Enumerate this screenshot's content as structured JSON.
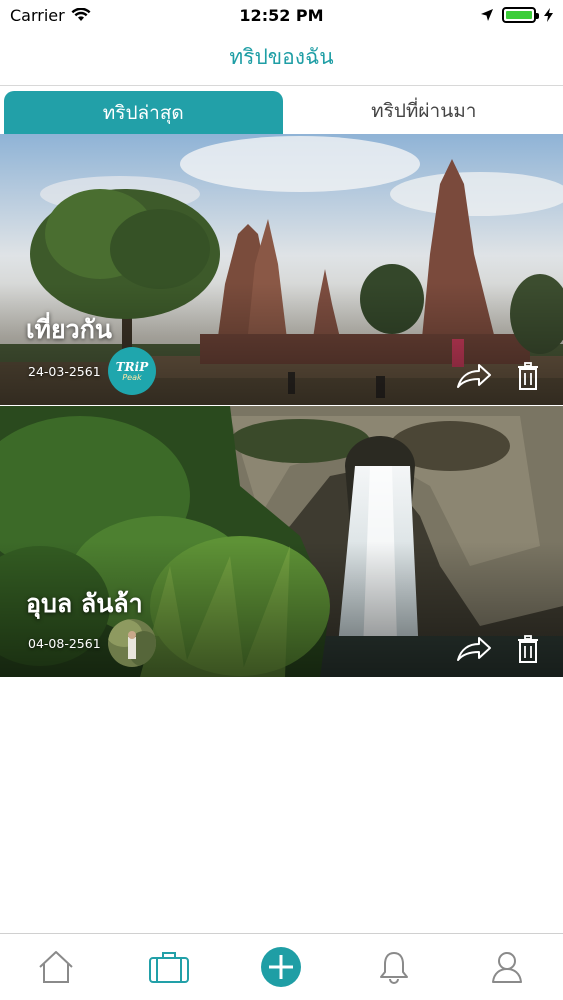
{
  "status_bar": {
    "carrier": "Carrier",
    "time": "12:52 PM",
    "battery_level": 1.0
  },
  "nav": {
    "title": "ทริปของฉัน"
  },
  "tabs": [
    {
      "label": "ทริปล่าสุด",
      "active": true
    },
    {
      "label": "ทริปที่ผ่านมา",
      "active": false
    }
  ],
  "trips": [
    {
      "title": "เที่ยวกัน",
      "date": "24-03-2561",
      "avatar_text": "TRiP",
      "avatar_sub": "Peak"
    },
    {
      "title": "อุบล ลันล้า",
      "date": "04-08-2561"
    }
  ],
  "tab_bar": {
    "items": [
      "home-icon",
      "briefcase-icon",
      "add-icon",
      "bell-icon",
      "profile-icon"
    ],
    "active": "briefcase-icon"
  },
  "colors": {
    "accent": "#22a0a8",
    "title": "#1f9ea5"
  }
}
